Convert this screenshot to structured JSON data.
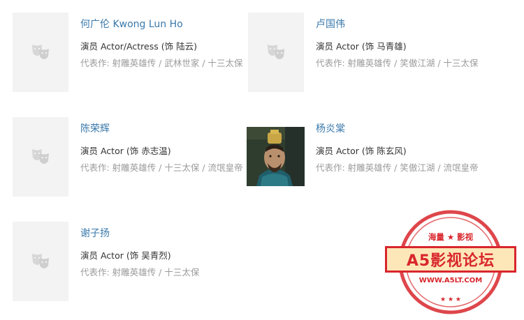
{
  "cast": [
    {
      "name": "何广伦 Kwong Lun Ho",
      "role": "演员 Actor/Actress (饰 陆云)",
      "works": "代表作:  射雕英雄传 / 武林世家 / 十三太保",
      "thumb_icon": "theater-mask-icon"
    },
    {
      "name": "卢国伟",
      "role": "演员 Actor (饰 马青雄)",
      "works": "代表作:  射雕英雄传 / 笑傲江湖 / 十三太保",
      "thumb_icon": "theater-mask-icon"
    },
    {
      "name": "陈荣辉",
      "role": "演员 Actor (饰 赤志温)",
      "works": "代表作:  射雕英雄传 / 十三太保 / 流氓皇帝",
      "thumb_icon": "theater-mask-icon"
    },
    {
      "name": "杨炎棠",
      "role": "演员 Actor (饰 陈玄风)",
      "works": "代表作:  射雕英雄传 / 笑傲江湖 / 流氓皇帝",
      "thumb_icon": "actor-photo"
    },
    {
      "name": "谢子扬",
      "role": "演员 Actor (饰 吴青烈)",
      "works": "代表作:  射雕英雄传 / 十三太保",
      "thumb_icon": "theater-mask-icon"
    }
  ],
  "watermark": {
    "top_text": "海量 ★ 影视",
    "title": "A5影视论坛",
    "url": "WWW.A5LT.COM",
    "color": "#d8262c"
  }
}
